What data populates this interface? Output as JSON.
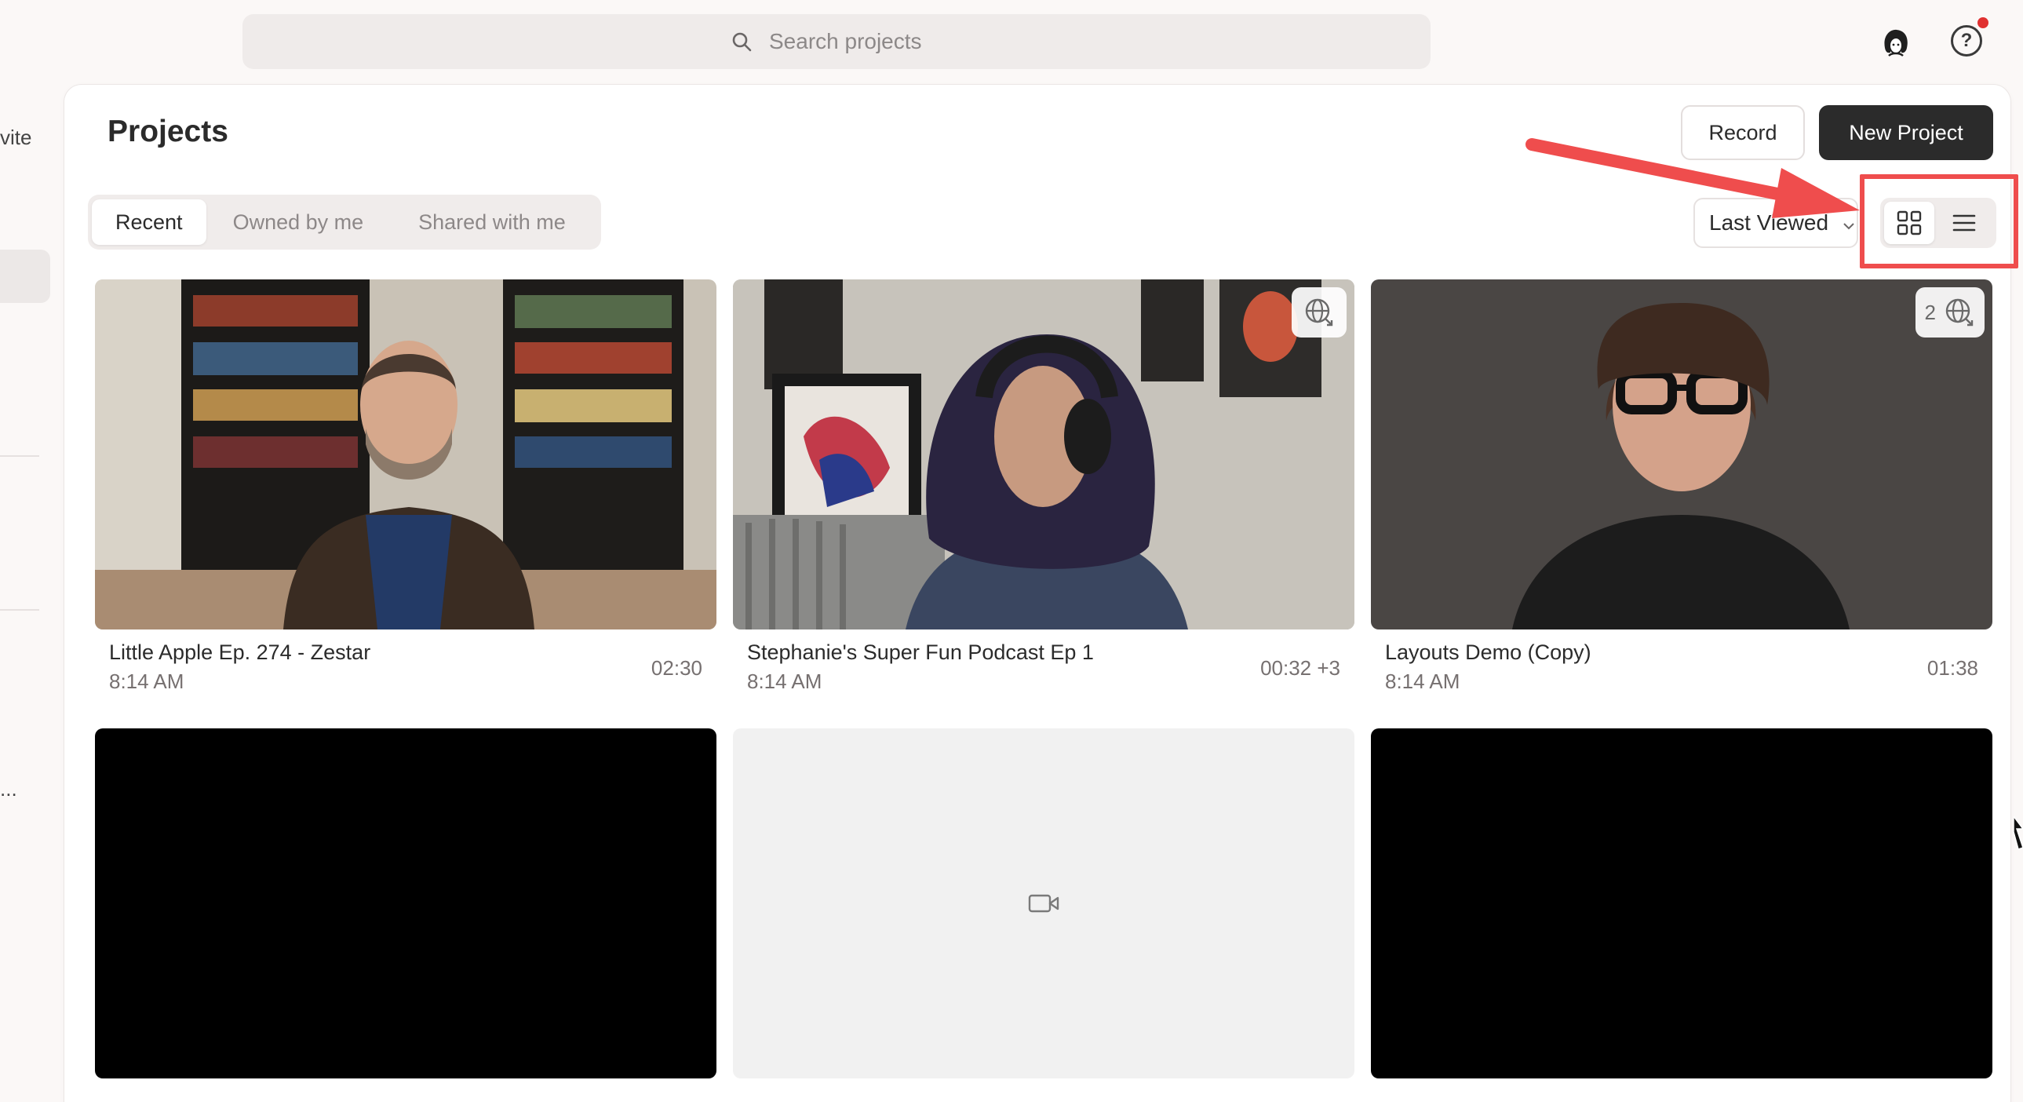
{
  "search": {
    "placeholder": "Search projects"
  },
  "sidebar": {
    "invite_fragment": "vite",
    "more_fragment": "..."
  },
  "page": {
    "title": "Projects"
  },
  "actions": {
    "record_label": "Record",
    "new_project_label": "New Project"
  },
  "tabs": [
    {
      "label": "Recent",
      "active": true
    },
    {
      "label": "Owned by me",
      "active": false
    },
    {
      "label": "Shared with me",
      "active": false
    }
  ],
  "sort": {
    "selected": "Last Viewed"
  },
  "view_modes": [
    {
      "icon": "grid-icon",
      "active": true
    },
    {
      "icon": "list-icon",
      "active": false
    }
  ],
  "colors": {
    "annotation": "#ef4d4d",
    "primary_button": "#2b2b2b",
    "notification_dot": "#e03131"
  },
  "projects": [
    {
      "title": "Little Apple Ep. 274 - Zestar",
      "time": "8:14 AM",
      "duration": "02:30",
      "share_count": ""
    },
    {
      "title": "Stephanie's Super Fun Podcast Ep 1",
      "time": "8:14 AM",
      "duration": "00:32 +3",
      "share_count": ""
    },
    {
      "title": "Layouts Demo (Copy)",
      "time": "8:14 AM",
      "duration": "01:38",
      "share_count": "2"
    },
    {
      "title": "",
      "time": "",
      "duration": "",
      "share_count": ""
    },
    {
      "title": "",
      "time": "",
      "duration": "",
      "share_count": ""
    },
    {
      "title": "",
      "time": "",
      "duration": "",
      "share_count": ""
    }
  ]
}
